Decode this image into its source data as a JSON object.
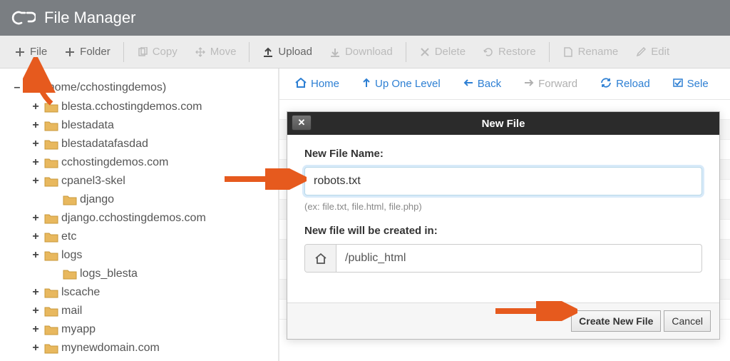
{
  "header": {
    "title": "File Manager"
  },
  "toolbar": {
    "file": "File",
    "folder": "Folder",
    "copy": "Copy",
    "move": "Move",
    "upload": "Upload",
    "download": "Download",
    "delete": "Delete",
    "restore": "Restore",
    "rename": "Rename",
    "edit": "Edit"
  },
  "nav": {
    "home": "Home",
    "up": "Up One Level",
    "back": "Back",
    "forward": "Forward",
    "reload": "Reload",
    "select": "Sele"
  },
  "tree": {
    "root": "(/home/cchostingdemos)",
    "items": [
      {
        "label": "blesta.cchostingdemos.com",
        "toggle": "+",
        "indent": 1
      },
      {
        "label": "blestadata",
        "toggle": "+",
        "indent": 1
      },
      {
        "label": "blestadatafasdad",
        "toggle": "+",
        "indent": 1
      },
      {
        "label": "cchostingdemos.com",
        "toggle": "+",
        "indent": 1
      },
      {
        "label": "cpanel3-skel",
        "toggle": "+",
        "indent": 1
      },
      {
        "label": "django",
        "toggle": "",
        "indent": 2
      },
      {
        "label": "django.cchostingdemos.com",
        "toggle": "+",
        "indent": 1
      },
      {
        "label": "etc",
        "toggle": "+",
        "indent": 1
      },
      {
        "label": "logs",
        "toggle": "+",
        "indent": 1
      },
      {
        "label": "logs_blesta",
        "toggle": "",
        "indent": 2
      },
      {
        "label": "lscache",
        "toggle": "+",
        "indent": 1
      },
      {
        "label": "mail",
        "toggle": "+",
        "indent": 1
      },
      {
        "label": "myapp",
        "toggle": "+",
        "indent": 1
      },
      {
        "label": "mynewdomain.com",
        "toggle": "+",
        "indent": 1
      }
    ]
  },
  "modal": {
    "title": "New File",
    "name_label": "New File Name:",
    "name_value": "robots.txt",
    "hint": "(ex: file.txt, file.html, file.php)",
    "path_label": "New file will be created in:",
    "path_value": "/public_html",
    "create": "Create New File",
    "cancel": "Cancel"
  }
}
